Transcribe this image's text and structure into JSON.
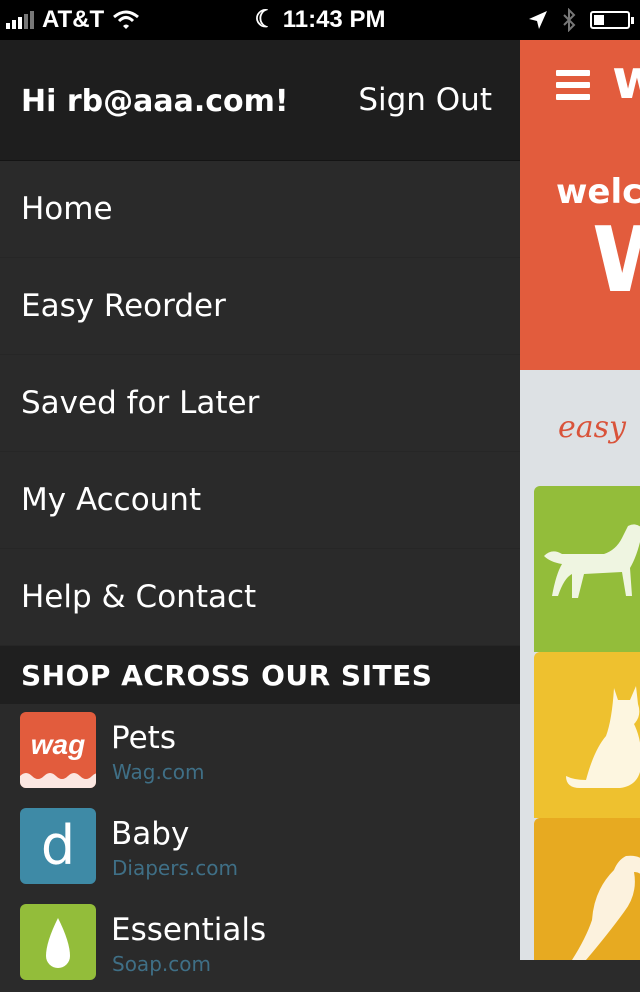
{
  "status_bar": {
    "carrier": "AT&T",
    "time": "11:43 PM",
    "battery_level": 0.3
  },
  "drawer": {
    "greeting": "Hi rb@aaa.com!",
    "sign_out": "Sign Out",
    "menu": [
      {
        "label": "Home"
      },
      {
        "label": "Easy Reorder"
      },
      {
        "label": "Saved for Later"
      },
      {
        "label": "My Account"
      },
      {
        "label": "Help & Contact"
      }
    ],
    "section_title": "SHOP ACROSS OUR SITES",
    "sites": [
      {
        "name": "Pets",
        "url": "Wag.com",
        "logo_text": "wag",
        "color": "#e25c3d"
      },
      {
        "name": "Baby",
        "url": "Diapers.com",
        "logo_text": "d",
        "color": "#3e8aa6"
      },
      {
        "name": "Essentials",
        "url": "Soap.com",
        "color": "#93bd3a"
      }
    ]
  },
  "main": {
    "logo_partial": "w",
    "welcome_partial": "welco",
    "big_partial": "W",
    "easy_partial": "easy",
    "tiles": [
      {
        "animal": "dog-icon",
        "color": "#93bd3a"
      },
      {
        "animal": "cat-icon",
        "color": "#eec12f"
      },
      {
        "animal": "bird-icon",
        "color": "#e7aa21"
      }
    ]
  }
}
